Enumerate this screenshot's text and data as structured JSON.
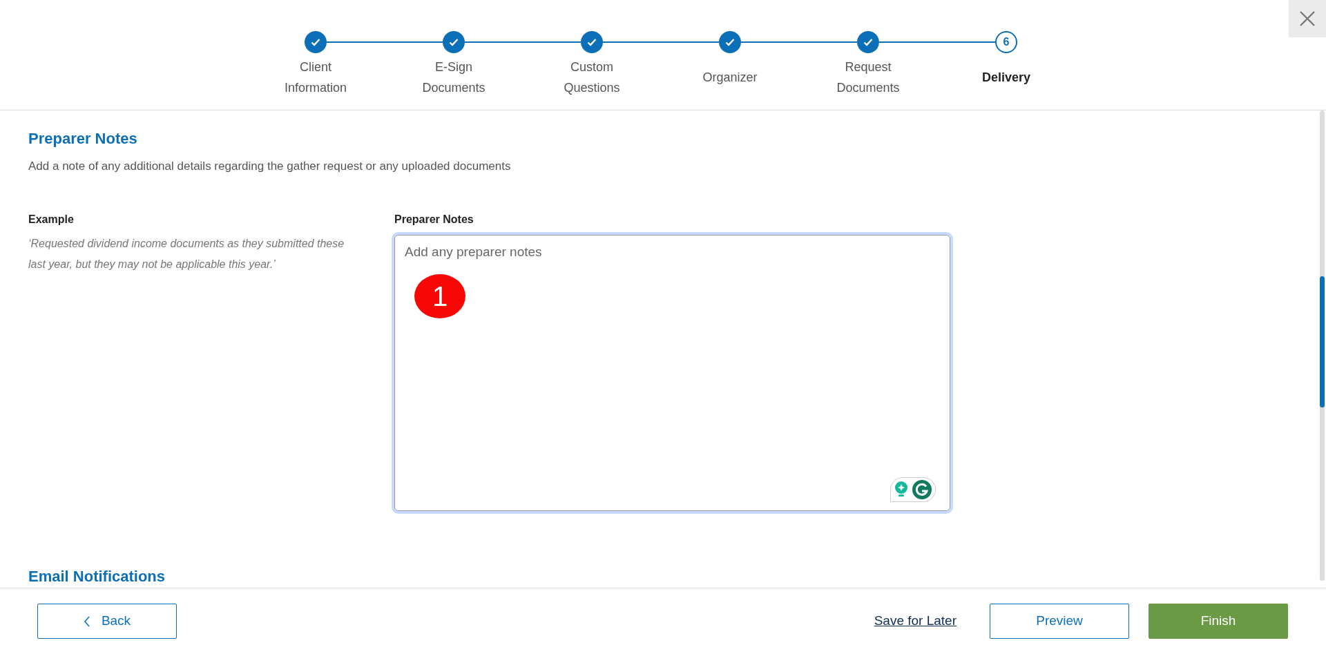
{
  "steps": [
    {
      "label": "Client Information",
      "completed": true,
      "selected": false
    },
    {
      "label": "E-Sign Documents",
      "completed": true,
      "selected": false
    },
    {
      "label": "Custom Questions",
      "completed": true,
      "selected": false
    },
    {
      "label": "Organizer",
      "completed": true,
      "selected": false
    },
    {
      "label": "Request Documents",
      "completed": true,
      "selected": false
    },
    {
      "label": "Delivery",
      "number": "6",
      "completed": false,
      "selected": true
    }
  ],
  "section": {
    "title": "Preparer Notes",
    "description": "Add a note of any additional details regarding the gather request or any uploaded documents"
  },
  "example": {
    "label": "Example",
    "text": "‘Requested dividend income documents as they submitted these last year, but they may not be applicable this year.’"
  },
  "notes_field": {
    "label": "Preparer Notes",
    "placeholder": "Add any preparer notes",
    "focused": true
  },
  "annotation": {
    "label": "1"
  },
  "next_section": {
    "title": "Email Notifications"
  },
  "footer": {
    "back": "Back",
    "save": "Save for Later",
    "preview": "Preview",
    "finish": "Finish"
  }
}
